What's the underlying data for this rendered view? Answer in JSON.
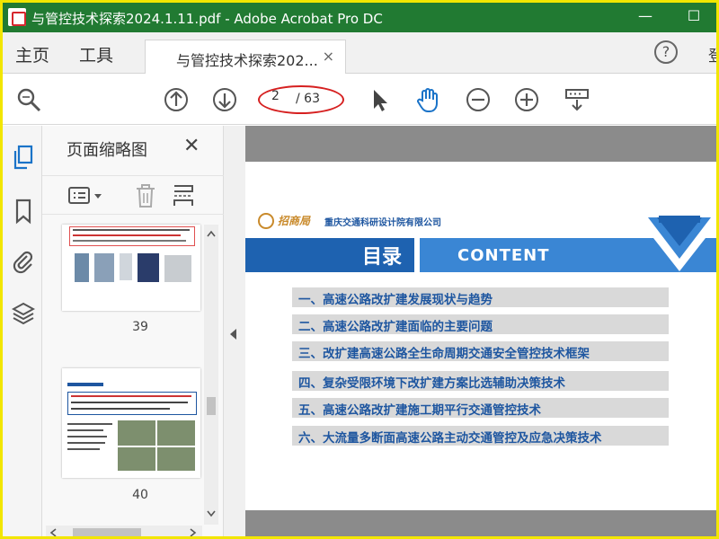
{
  "window": {
    "title": "与管控技术探索2024.1.11.pdf - Adobe Acrobat Pro DC",
    "minimize_symbol": "—",
    "maximize_symbol": "☐"
  },
  "menu": {
    "home": "主页",
    "tools": "工具",
    "doc_tab": "与管控技术探索202...",
    "tab_close": "×",
    "help": "?",
    "signin": "登"
  },
  "toolbar": {
    "current_page": "2",
    "total_pages": "/ 63"
  },
  "thumbnails": {
    "header": "页面缩略图",
    "close": "✕",
    "pages": [
      {
        "number": "39"
      },
      {
        "number": "40"
      }
    ]
  },
  "document": {
    "logo_brand": "招商局",
    "logo_name": "重庆交通科研设计院有限公司",
    "heading_cn": "目录",
    "heading_en": "CONTENT",
    "toc": [
      "一、高速公路改扩建发展现状与趋势",
      "二、高速公路改扩建面临的主要问题",
      "三、改扩建高速公路全生命周期交通安全管控技术框架",
      "四、复杂受限环境下改扩建方案比选辅助决策技术",
      "五、高速公路改扩建施工期平行交通管控技术",
      "六、大流量多断面高速公路主动交通管控及应急决策技术"
    ]
  },
  "colors": {
    "titlebar": "#217a32",
    "highlight_border": "#f2e600",
    "annotation_red": "#d62020",
    "doc_blue": "#1e62b0",
    "doc_light_blue": "#3a86d4"
  }
}
